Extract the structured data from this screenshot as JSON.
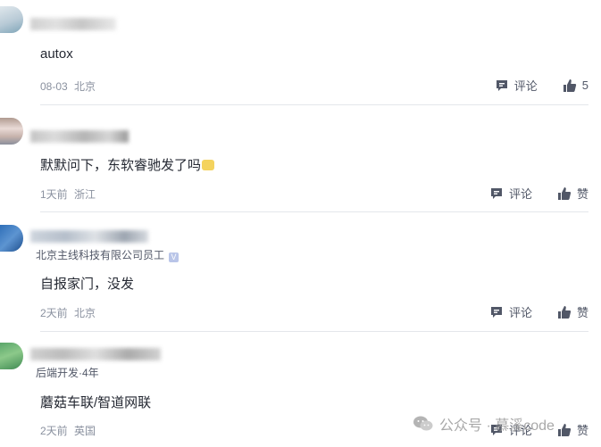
{
  "comments": [
    {
      "content": "autox",
      "date": "08-03",
      "location": "北京",
      "reply_label": "评论",
      "like_label": "5",
      "badge": ""
    },
    {
      "content": "默默问下，东软睿驰发了吗",
      "date": "1天前",
      "location": "浙江",
      "reply_label": "评论",
      "like_label": "赞",
      "badge": ""
    },
    {
      "content": "自报家门，没发",
      "date": "2天前",
      "location": "北京",
      "reply_label": "评论",
      "like_label": "赞",
      "badge": "北京主线科技有限公司员工"
    },
    {
      "content": "蘑菇车联/智道网联",
      "date": "2天前",
      "location": "英国",
      "reply_label": "评论",
      "like_label": "赞",
      "badge": "后端开发·4年"
    }
  ],
  "watermark": {
    "text": "公众号 · 慕溪code"
  },
  "icons": {
    "reply": "comment-icon",
    "like": "thumbs-up-icon",
    "watermark": "wechat-icon"
  }
}
